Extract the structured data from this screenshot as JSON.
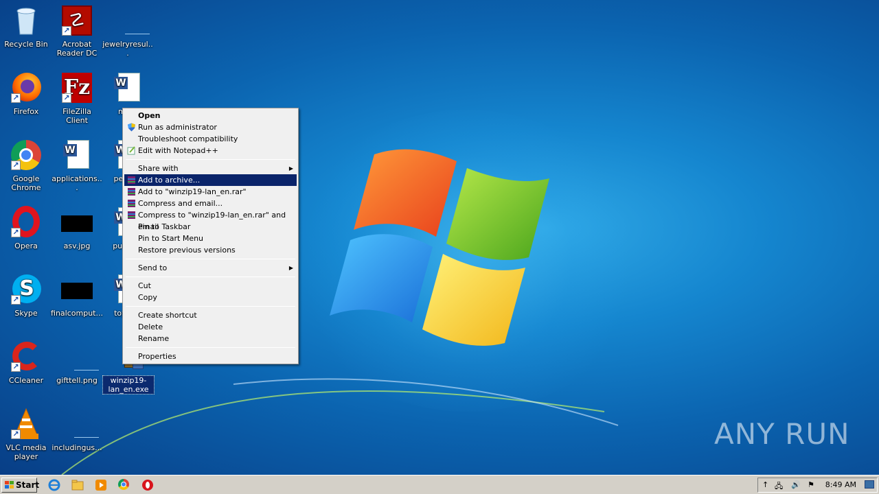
{
  "desktop": {
    "icons": [
      {
        "label": "Recycle Bin",
        "icon": "recycle-bin-icon"
      },
      {
        "label": "Acrobat Reader DC",
        "icon": "acrobat-icon"
      },
      {
        "label": "jewelryresul...",
        "icon": "blank-file-icon"
      },
      {
        "label": "Firefox",
        "icon": "firefox-icon"
      },
      {
        "label": "FileZilla Client",
        "icon": "filezilla-icon"
      },
      {
        "label": "me...",
        "icon": "word-doc-icon"
      },
      {
        "label": "Google Chrome",
        "icon": "chrome-icon"
      },
      {
        "label": "applications...",
        "icon": "word-doc-icon"
      },
      {
        "label": "perso...",
        "icon": "word-doc-icon"
      },
      {
        "label": "Opera",
        "icon": "opera-icon"
      },
      {
        "label": "asv.jpg",
        "icon": "image-file-icon"
      },
      {
        "label": "public...",
        "icon": "word-doc-icon"
      },
      {
        "label": "Skype",
        "icon": "skype-icon"
      },
      {
        "label": "finalcomput...",
        "icon": "image-file-icon"
      },
      {
        "label": "toysc...",
        "icon": "word-doc-icon"
      },
      {
        "label": "CCleaner",
        "icon": "ccleaner-icon"
      },
      {
        "label": "gifttell.png",
        "icon": "blank-file-icon"
      },
      {
        "label": "winzip19-lan_en.exe",
        "icon": "installer-icon"
      },
      {
        "label": "VLC media player",
        "icon": "vlc-icon"
      },
      {
        "label": "includingus...",
        "icon": "blank-file-icon"
      }
    ]
  },
  "context_menu": {
    "items": [
      {
        "label": "Open",
        "bold": true
      },
      {
        "label": "Run as administrator",
        "icon": "uac-shield-icon"
      },
      {
        "label": "Troubleshoot compatibility"
      },
      {
        "label": "Edit with Notepad++",
        "icon": "notepadpp-icon"
      },
      {
        "label": "Share with",
        "submenu": true
      },
      {
        "label": "Add to archive...",
        "icon": "winrar-icon",
        "highlighted": true
      },
      {
        "label": "Add to \"winzip19-lan_en.rar\"",
        "icon": "winrar-icon"
      },
      {
        "label": "Compress and email...",
        "icon": "winrar-icon"
      },
      {
        "label": "Compress to \"winzip19-lan_en.rar\" and email",
        "icon": "winrar-icon"
      },
      {
        "label": "Pin to Taskbar"
      },
      {
        "label": "Pin to Start Menu"
      },
      {
        "label": "Restore previous versions"
      },
      {
        "label": "Send to",
        "submenu": true
      },
      {
        "label": "Cut"
      },
      {
        "label": "Copy"
      },
      {
        "label": "Create shortcut"
      },
      {
        "label": "Delete"
      },
      {
        "label": "Rename"
      },
      {
        "label": "Properties"
      }
    ]
  },
  "taskbar": {
    "start_label": "Start",
    "pinned": [
      "ie-icon",
      "explorer-icon",
      "media-player-icon",
      "chrome-icon",
      "opera-icon"
    ],
    "clock": "8:49 AM"
  },
  "watermark": {
    "text": "ANY RUN"
  },
  "colors": {
    "menu_highlight": "#0a246a",
    "taskbar": "#d4d0c8"
  }
}
